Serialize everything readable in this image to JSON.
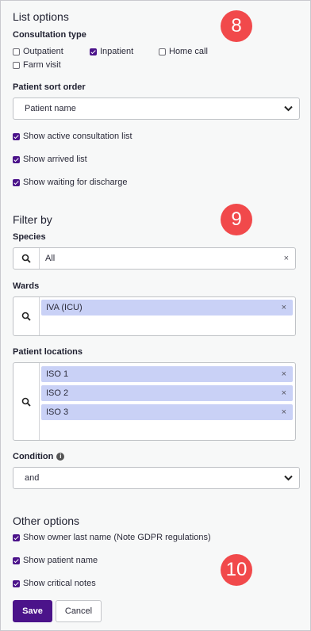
{
  "list_options": {
    "title": "List options",
    "consultation_type": {
      "label": "Consultation type",
      "options": [
        {
          "label": "Outpatient",
          "checked": false
        },
        {
          "label": "Inpatient",
          "checked": true
        },
        {
          "label": "Home call",
          "checked": false
        },
        {
          "label": "Farm visit",
          "checked": false
        }
      ]
    },
    "sort_order": {
      "label": "Patient sort order",
      "value": "Patient name"
    },
    "toggles": [
      {
        "label": "Show active consultation list",
        "checked": true
      },
      {
        "label": "Show arrived list",
        "checked": true
      },
      {
        "label": "Show waiting for discharge",
        "checked": true
      }
    ]
  },
  "filter_by": {
    "title": "Filter by",
    "species": {
      "label": "Species",
      "value": "All"
    },
    "wards": {
      "label": "Wards",
      "chips": [
        "IVA (ICU)"
      ]
    },
    "patient_locations": {
      "label": "Patient locations",
      "chips": [
        "ISO 1",
        "ISO 2",
        "ISO 3"
      ]
    },
    "condition": {
      "label": "Condition",
      "value": "and",
      "info_icon": "info-icon"
    }
  },
  "other_options": {
    "title": "Other options",
    "toggles": [
      {
        "label": "Show owner last name (Note GDPR regulations)",
        "checked": true
      },
      {
        "label": "Show patient name",
        "checked": true
      },
      {
        "label": "Show critical notes",
        "checked": true
      }
    ]
  },
  "actions": {
    "save": "Save",
    "cancel": "Cancel"
  },
  "badges": {
    "list_options": "8",
    "filter_by": "9",
    "other_options": "10"
  },
  "colors": {
    "accent": "#4b138a",
    "badge": "#f1494b",
    "chip": "#c9d1f6"
  },
  "remove_glyph": "×"
}
